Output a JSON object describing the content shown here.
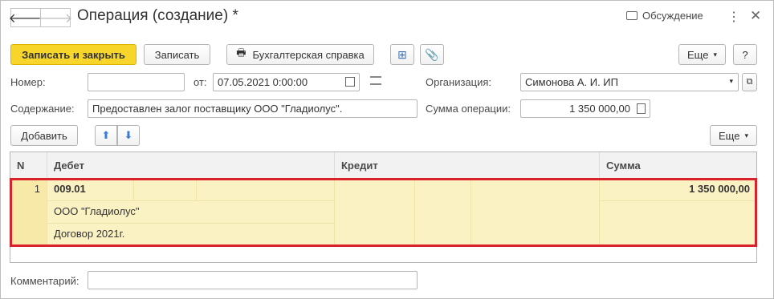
{
  "header": {
    "title": "Операция (создание) *",
    "discussion_label": "Обсуждение",
    "back_icon": "arrow-left-icon",
    "forward_icon": "arrow-right-icon"
  },
  "toolbar": {
    "save_close_label": "Записать и закрыть",
    "save_label": "Записать",
    "report_label": "Бухгалтерская справка",
    "more_label": "Еще",
    "help_label": "?"
  },
  "form": {
    "number_label": "Номер:",
    "number_value": "",
    "date_label": "от:",
    "date_value": "07.05.2021  0:00:00",
    "org_label": "Организация:",
    "org_value": "Симонова А. И. ИП",
    "content_label": "Содержание:",
    "content_value": "Предоставлен залог поставщику ООО \"Гладиолус\".",
    "sum_label": "Сумма операции:",
    "sum_value": "1 350 000,00",
    "comment_label": "Комментарий:",
    "comment_value": ""
  },
  "table_toolbar": {
    "add_label": "Добавить",
    "more_label": "Еще"
  },
  "table": {
    "headers": {
      "n": "N",
      "debit": "Дебет",
      "credit": "Кредит",
      "sum": "Сумма"
    },
    "rows": [
      {
        "n": "1",
        "debit_account": "009.01",
        "debit_subconto1": "ООО \"Гладиолус\"",
        "debit_subconto2": "Договор 2021г.",
        "sum": "1 350 000,00"
      }
    ]
  },
  "colors": {
    "accent": "#f7d52a",
    "row_highlight": "#fbf2c4",
    "selection_border": "#d9222a"
  }
}
